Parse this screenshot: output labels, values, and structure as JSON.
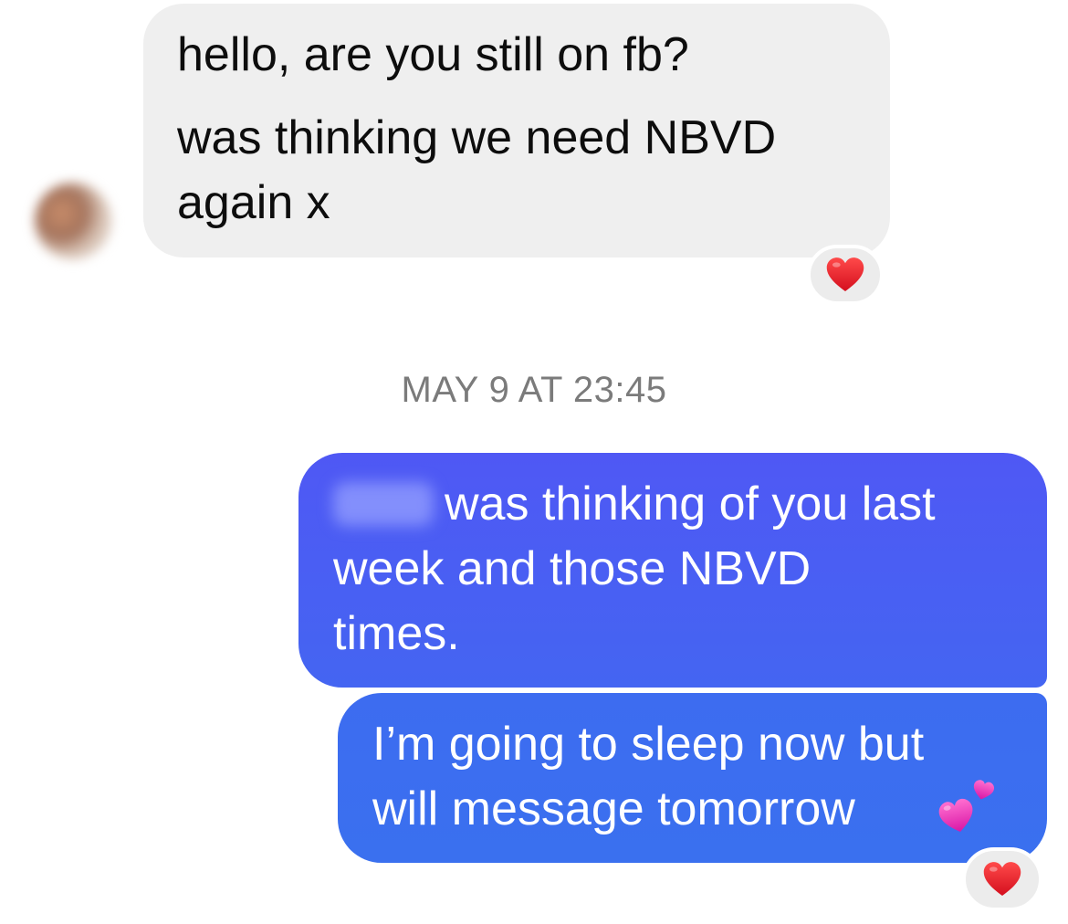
{
  "conversation": {
    "incoming": {
      "lines": [
        "hello, are you still on fb?",
        "was thinking we need NBVD",
        "again x"
      ],
      "reaction": "red-heart-icon"
    },
    "timestamp": "MAY 9 AT 23:45",
    "outgoing": [
      {
        "lines": [
          "was thinking of you last",
          "week and those NBVD",
          "times."
        ]
      },
      {
        "lines": [
          "I’m going to sleep now but",
          "will message tomorrow"
        ],
        "emoji": "two-hearts-icon",
        "reaction": "red-heart-icon"
      }
    ]
  },
  "colors": {
    "incoming_bubble": "#efefef",
    "outgoing_bubble_top": "#4f58f4",
    "outgoing_bubble_bottom": "#3a70ef",
    "timestamp_text": "#7b7b7b",
    "reaction_chip": "#ececec",
    "heart": "#e8182b"
  }
}
